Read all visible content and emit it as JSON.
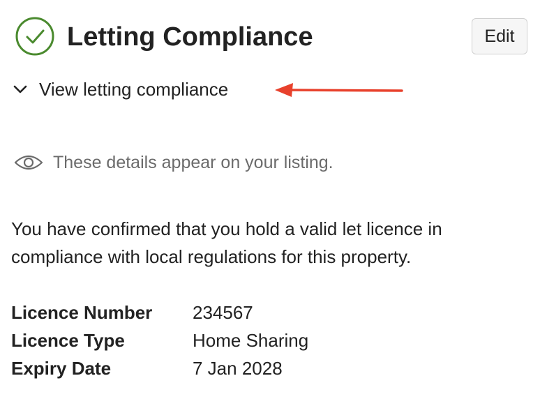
{
  "header": {
    "title": "Letting Compliance",
    "status_icon": "check-circle-icon",
    "edit_label": "Edit"
  },
  "disclosure": {
    "label": "View letting compliance",
    "icon": "chevron-down-icon"
  },
  "visibility": {
    "icon": "eye-icon",
    "text": "These details appear on your listing."
  },
  "confirmation": {
    "text": "You have confirmed that you hold a valid let licence in compliance with local regulations for this property."
  },
  "details": [
    {
      "label": "Licence Number",
      "value": "234567"
    },
    {
      "label": "Licence Type",
      "value": "Home Sharing"
    },
    {
      "label": "Expiry Date",
      "value": "7 Jan 2028"
    }
  ],
  "colors": {
    "success_green": "#4a8a2e",
    "annotation_red": "#e8412c",
    "muted_text": "#6b6b6b",
    "text": "#222222"
  }
}
